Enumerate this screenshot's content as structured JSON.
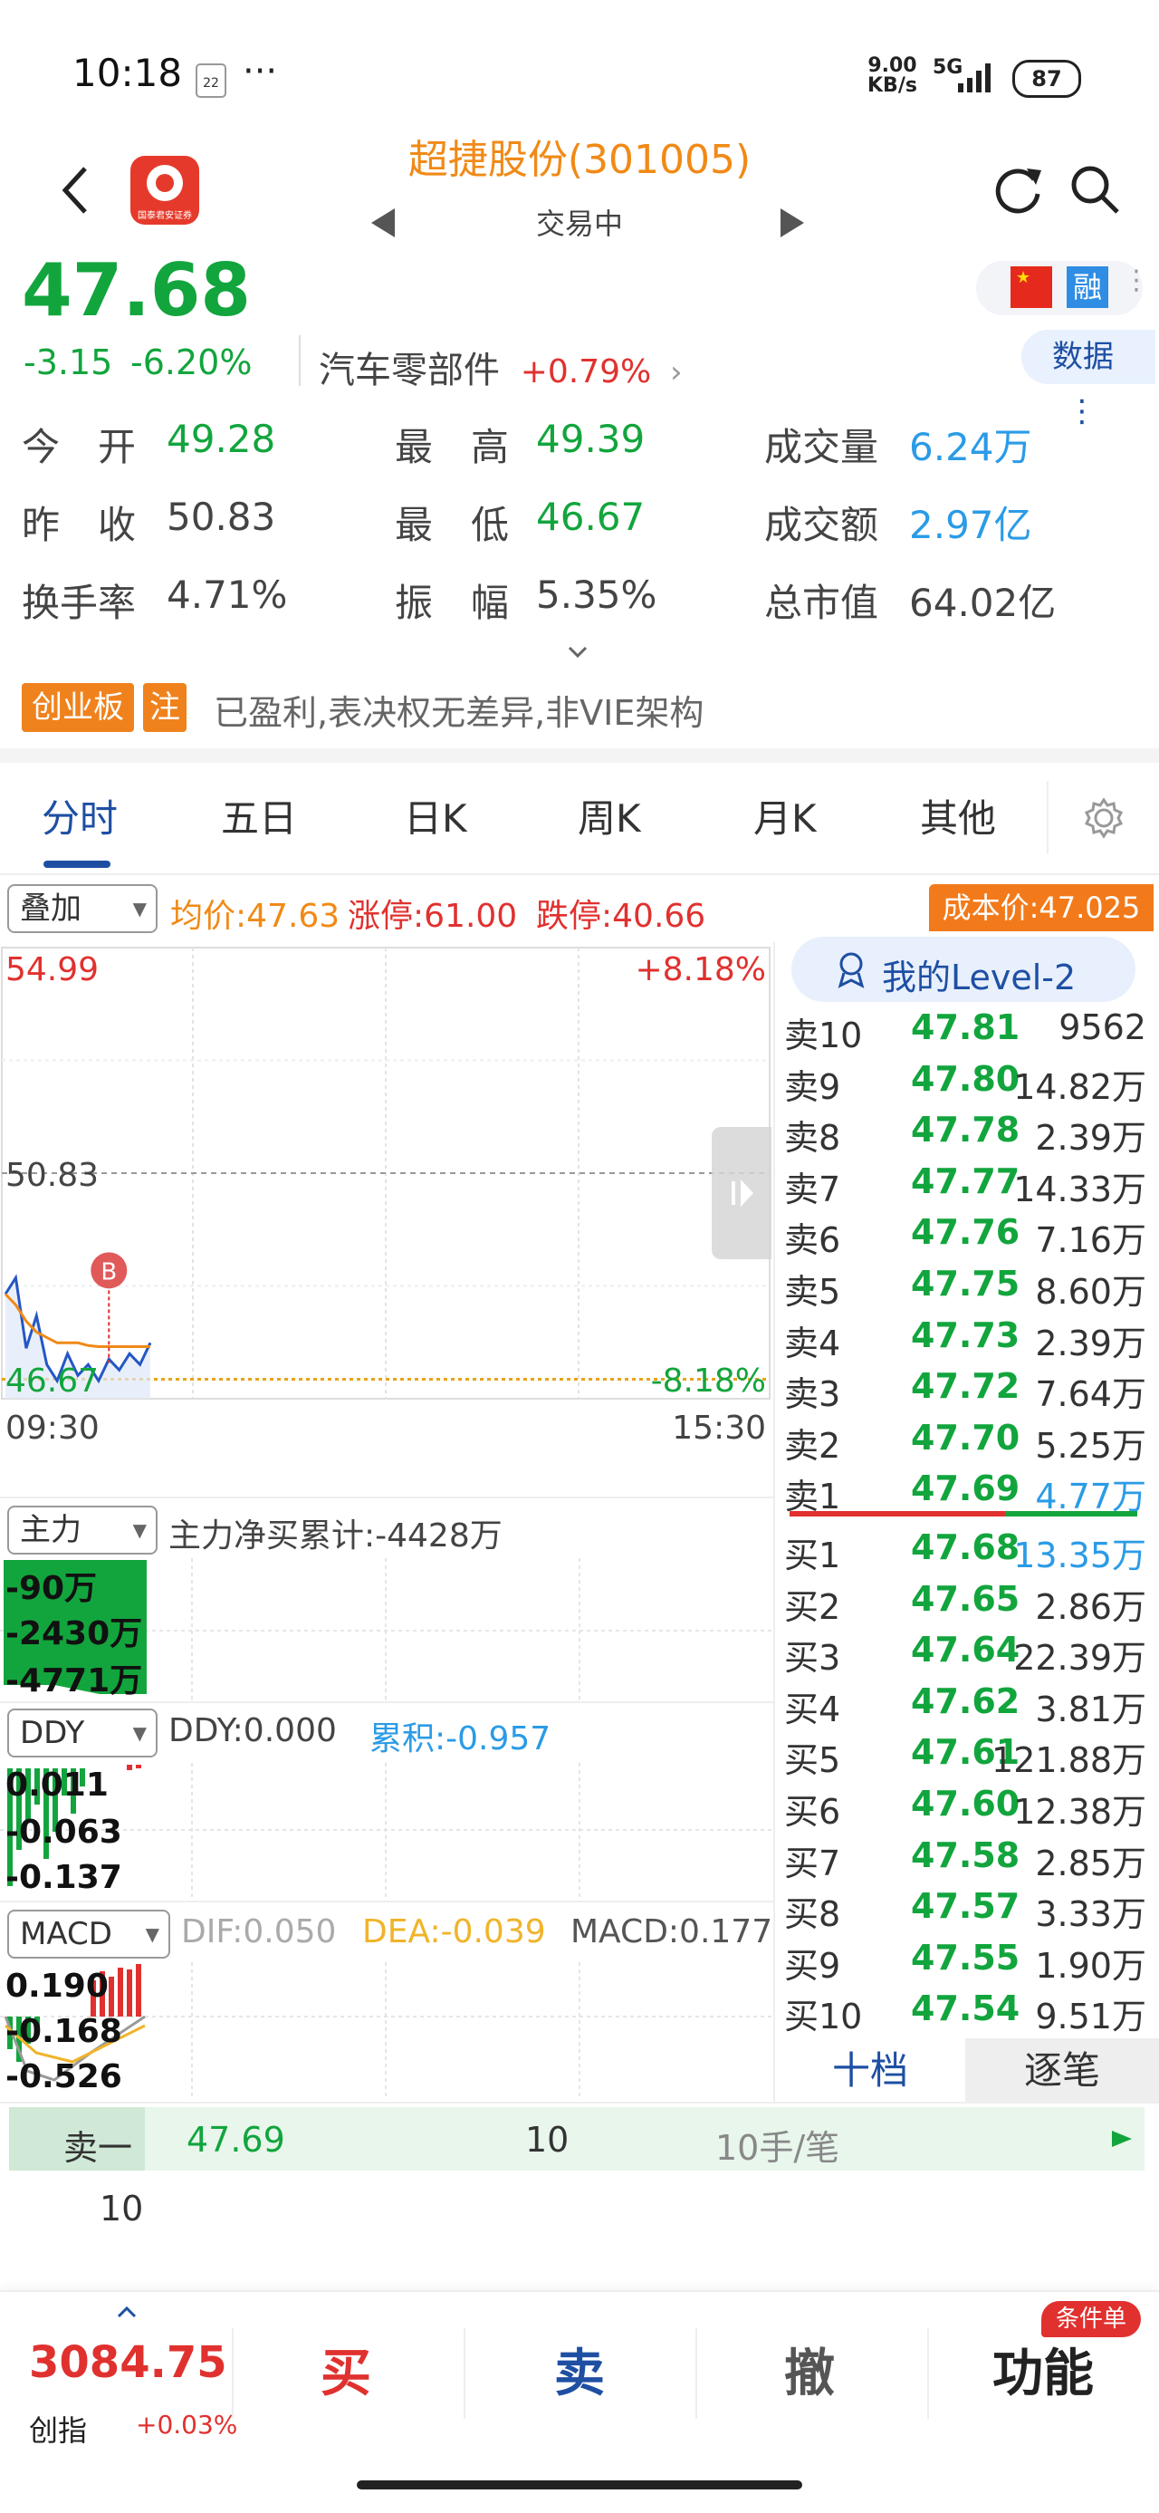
{
  "status_bar": {
    "time": "10:18",
    "notif_badge": "22",
    "ellipsis": "···",
    "net_speed_top": "9.00",
    "net_speed_bottom": "KB/s",
    "network": "5G",
    "battery": "87"
  },
  "header": {
    "title": "超捷股份(301005)",
    "subtitle": "交易中",
    "app_logo_caption": "国泰君安证券"
  },
  "quote": {
    "price": "47.68",
    "change": "-3.15",
    "change_pct": "-6.20%",
    "sector_name": "汽车零部件",
    "sector_change": "+0.79%",
    "tag_rong": "融",
    "data_button": "数据",
    "stats": [
      {
        "label": "今　开",
        "value": "49.28",
        "color": "green"
      },
      {
        "label": "最　高",
        "value": "49.39",
        "color": "green"
      },
      {
        "label": "成交量",
        "value": "6.24万",
        "color": "blue"
      },
      {
        "label": "昨　收",
        "value": "50.83",
        "color": "gray"
      },
      {
        "label": "最　低",
        "value": "46.67",
        "color": "green"
      },
      {
        "label": "成交额",
        "value": "2.97亿",
        "color": "blue"
      },
      {
        "label": "换手率",
        "value": "4.71%",
        "color": "gray"
      },
      {
        "label": "振　幅",
        "value": "5.35%",
        "color": "gray"
      },
      {
        "label": "总市值",
        "value": "64.02亿",
        "color": "gray"
      }
    ]
  },
  "board": {
    "tag1": "创业板",
    "tag2": "注",
    "desc": "已盈利,表决权无差异,非VIE架构"
  },
  "tabs": [
    "分时",
    "五日",
    "日K",
    "周K",
    "月K",
    "其他"
  ],
  "active_tab": 0,
  "overlay": {
    "select": "叠加",
    "avg_price": "均价:47.63",
    "limit_up": "涨停:61.00",
    "limit_down": "跌停:40.66",
    "cost_price": "成本价:47.025"
  },
  "chart_data": {
    "type": "line",
    "title": "",
    "y_top_label": "54.99",
    "y_mid_label": "50.83",
    "y_bottom_label": "46.67",
    "pct_top": "+8.18%",
    "pct_bottom": "-8.18%",
    "x_start": "09:30",
    "x_end": "15:30",
    "ylim": [
      46.67,
      54.99
    ],
    "marker": "B",
    "series": [
      {
        "values": [
          48.6,
          48.9,
          47.6,
          48.2,
          47.3,
          47.0,
          47.5,
          47.1,
          47.3,
          47.0,
          47.4,
          47.2,
          47.5,
          47.3,
          47.7
        ]
      },
      {
        "values": [
          48.6,
          48.4,
          48.1,
          47.9,
          47.8,
          47.7,
          47.7,
          47.7,
          47.65,
          47.63,
          47.63,
          47.63,
          47.63,
          47.63,
          47.63
        ]
      }
    ],
    "reference_line": 47.03
  },
  "level2": {
    "title": "我的Level-2",
    "asks": [
      {
        "label": "卖10",
        "price": "47.81",
        "vol": "9562"
      },
      {
        "label": "卖9",
        "price": "47.80",
        "vol": "14.82万"
      },
      {
        "label": "卖8",
        "price": "47.78",
        "vol": "2.39万"
      },
      {
        "label": "卖7",
        "price": "47.77",
        "vol": "14.33万"
      },
      {
        "label": "卖6",
        "price": "47.76",
        "vol": "7.16万"
      },
      {
        "label": "卖5",
        "price": "47.75",
        "vol": "8.60万"
      },
      {
        "label": "卖4",
        "price": "47.73",
        "vol": "2.39万"
      },
      {
        "label": "卖3",
        "price": "47.72",
        "vol": "7.64万"
      },
      {
        "label": "卖2",
        "price": "47.70",
        "vol": "5.25万"
      },
      {
        "label": "卖1",
        "price": "47.69",
        "vol": "4.77万"
      }
    ],
    "bids": [
      {
        "label": "买1",
        "price": "47.68",
        "vol": "13.35万"
      },
      {
        "label": "买2",
        "price": "47.65",
        "vol": "2.86万"
      },
      {
        "label": "买3",
        "price": "47.64",
        "vol": "22.39万"
      },
      {
        "label": "买4",
        "price": "47.62",
        "vol": "3.81万"
      },
      {
        "label": "买5",
        "price": "47.61",
        "vol": "121.88万"
      },
      {
        "label": "买6",
        "price": "47.60",
        "vol": "12.38万"
      },
      {
        "label": "买7",
        "price": "47.58",
        "vol": "2.85万"
      },
      {
        "label": "买8",
        "price": "47.57",
        "vol": "3.33万"
      },
      {
        "label": "买9",
        "price": "47.55",
        "vol": "1.90万"
      },
      {
        "label": "买10",
        "price": "47.54",
        "vol": "9.51万"
      }
    ],
    "tab_ten": "十档",
    "tab_tick": "逐笔"
  },
  "main_force": {
    "select": "主力",
    "summary": "主力净买累计:-4428万",
    "labels": [
      "-90万",
      "-2430万",
      "-4771万"
    ]
  },
  "ddy": {
    "select": "DDY",
    "value": "DDY:0.000",
    "cumulative": "累积:-0.957",
    "labels": [
      "0.011",
      "-0.063",
      "-0.137"
    ]
  },
  "macd": {
    "select": "MACD",
    "dif": "DIF:0.050",
    "dea": "DEA:-0.039",
    "macd": "MACD:0.177",
    "labels": [
      "0.190",
      "-0.168",
      "-0.526"
    ]
  },
  "trade_strip": {
    "label": "卖一",
    "price": "47.69",
    "qty": "10",
    "per": "10手/笔",
    "qty2": "10"
  },
  "bottom_bar": {
    "index_value": "3084.75",
    "index_name": "创指",
    "index_change": "+0.03%",
    "buy": "买",
    "sell": "卖",
    "cancel": "撤",
    "func": "功能",
    "cond_badge": "条件单"
  },
  "colors": {
    "up": "#e0312f",
    "down": "#12a53d",
    "accent": "#f08a17",
    "blue": "#2b9be6",
    "nav_blue": "#1e4fa3"
  }
}
